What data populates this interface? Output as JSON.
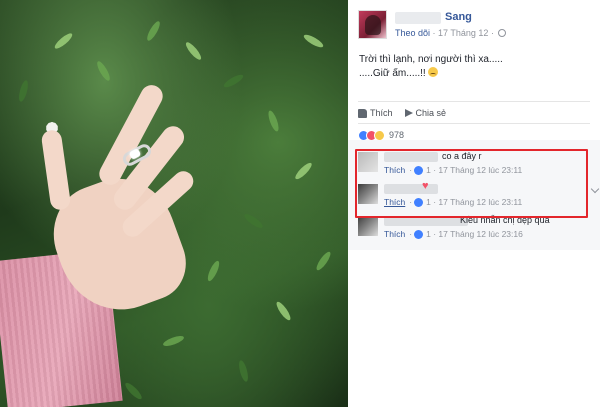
{
  "post": {
    "author_name": "Sang",
    "follow_label": "Theo dõi",
    "date": "17 Tháng 12",
    "text_line1": "Trời thì lạnh, nơi người thì xa.....",
    "text_line2": ".....Giữ ấm.....!!",
    "like_label": "Thích",
    "share_label": "Chia sẻ",
    "reaction_count": "978"
  },
  "comments": [
    {
      "text": "co a đây r",
      "like_label": "Thích",
      "like_count": "1",
      "timestamp": "17 Tháng 12 lúc 23:11"
    },
    {
      "text": "",
      "like_label": "Thích",
      "like_count": "1",
      "timestamp": "17 Tháng 12 lúc 23:11"
    },
    {
      "text": "Kiều nhẫn chị đẹp quá",
      "like_label": "Thích",
      "like_count": "1",
      "timestamp": "17 Tháng 12 lúc 23:16"
    }
  ],
  "colors": {
    "link": "#365899",
    "highlight": "#e3262c",
    "like_blue": "#4080ff",
    "love_red": "#f25268"
  },
  "icons": [
    "globe-icon",
    "like-icon",
    "share-icon",
    "love-reaction-icon",
    "wow-reaction-icon",
    "heart-icon",
    "chevron-down-icon"
  ]
}
